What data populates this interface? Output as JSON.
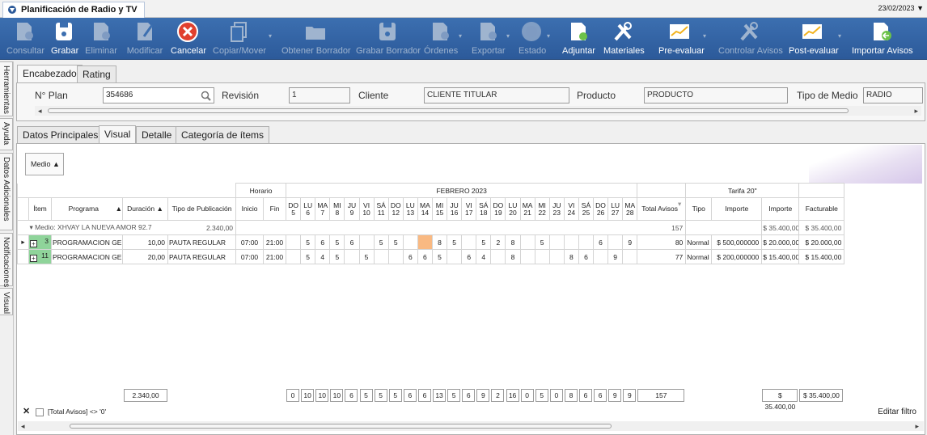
{
  "window": {
    "title": "Planificación de Radio y TV",
    "date": "23/02/2023"
  },
  "ribbon": [
    {
      "label": "Consultar",
      "enabled": false,
      "icon": "consultar-icon"
    },
    {
      "label": "Grabar",
      "enabled": true,
      "icon": "save-icon"
    },
    {
      "label": "Eliminar",
      "enabled": false,
      "icon": "delete-doc-icon"
    },
    {
      "label": "Modificar",
      "enabled": false,
      "icon": "edit-icon"
    },
    {
      "label": "Cancelar",
      "enabled": true,
      "icon": "cancel-icon"
    },
    {
      "label": "Copiar/Mover",
      "enabled": false,
      "icon": "copy-icon"
    },
    {
      "label": "Obtener Borrador",
      "enabled": false,
      "icon": "folder-icon"
    },
    {
      "label": "Grabar Borrador",
      "enabled": false,
      "icon": "save-draft-icon"
    },
    {
      "label": "Órdenes",
      "enabled": false,
      "icon": "orders-icon"
    },
    {
      "label": "Exportar",
      "enabled": false,
      "icon": "export-icon"
    },
    {
      "label": "Estado",
      "enabled": false,
      "icon": "status-icon"
    },
    {
      "label": "Adjuntar",
      "enabled": true,
      "icon": "attach-icon"
    },
    {
      "label": "Materiales",
      "enabled": true,
      "icon": "tools-icon"
    },
    {
      "label": "Pre-evaluar",
      "enabled": true,
      "icon": "chart-icon"
    },
    {
      "label": "Controlar Avisos",
      "enabled": false,
      "icon": "tools-disabled-icon"
    },
    {
      "label": "Post-evaluar",
      "enabled": true,
      "icon": "chart-post-icon"
    },
    {
      "label": "Importar Avisos",
      "enabled": true,
      "icon": "import-icon"
    }
  ],
  "side_tabs": [
    "Herramientas",
    "Ayuda",
    "Datos Adicionales",
    "Notificaciones",
    "Visual"
  ],
  "header": {
    "tabs": [
      "Encabezado",
      "Rating"
    ],
    "labels": {
      "plan": "N° Plan",
      "revision": "Revisión",
      "cliente": "Cliente",
      "producto": "Producto",
      "tipo_medio": "Tipo de Medio"
    },
    "values": {
      "plan": "354686",
      "revision": "1",
      "cliente": "CLIENTE TITULAR",
      "producto": "PRODUCTO",
      "tipo_medio": "RADIO"
    }
  },
  "content_tabs": [
    "Datos Principales",
    "Visual",
    "Detalle",
    "Categoría de ítems"
  ],
  "medio_button": "Medio",
  "grid": {
    "horario_header": "Horario",
    "month_header": "FEBRERO 2023",
    "tarifa_header": "Tarifa 20\"",
    "cols": {
      "item": "Ítem",
      "programa": "Programa",
      "duracion": "Duración",
      "tipo_pub": "Tipo de Publicación",
      "inicio": "Inicio",
      "fin": "Fin",
      "total_avisos": "Total Avisos",
      "tipo": "Tipo",
      "importe1": "Importe",
      "importe2": "Importe",
      "facturable": "Facturable"
    },
    "days": [
      [
        "DO",
        "5"
      ],
      [
        "LU",
        "6"
      ],
      [
        "MA",
        "7"
      ],
      [
        "MI",
        "8"
      ],
      [
        "JU",
        "9"
      ],
      [
        "VI",
        "10"
      ],
      [
        "SÁ",
        "11"
      ],
      [
        "DO",
        "12"
      ],
      [
        "LU",
        "13"
      ],
      [
        "MA",
        "14"
      ],
      [
        "MI",
        "15"
      ],
      [
        "JU",
        "16"
      ],
      [
        "VI",
        "17"
      ],
      [
        "SÁ",
        "18"
      ],
      [
        "DO",
        "19"
      ],
      [
        "LU",
        "20"
      ],
      [
        "MA",
        "21"
      ],
      [
        "MI",
        "22"
      ],
      [
        "JU",
        "23"
      ],
      [
        "VI",
        "24"
      ],
      [
        "SÁ",
        "25"
      ],
      [
        "DO",
        "26"
      ],
      [
        "LU",
        "27"
      ],
      [
        "MA",
        "28"
      ]
    ],
    "group": {
      "label": "Medio: XHVAY LA NUEVA AMOR 92.7",
      "duracion": "2.340,00",
      "total_avisos": "157",
      "importe2": "$ 35.400,00",
      "facturable": "$ 35.400,00"
    },
    "rows": [
      {
        "item": "3",
        "programa": "PROGRAMACION GENERAL",
        "duracion": "10,00",
        "tipo_pub": "PAUTA REGULAR",
        "inicio": "07:00",
        "fin": "21:00",
        "days": [
          "",
          "5",
          "6",
          "5",
          "6",
          "",
          "5",
          "5",
          "",
          "",
          "8",
          "5",
          "",
          "5",
          "2",
          "8",
          "",
          "5",
          "",
          "",
          "",
          "6",
          "",
          "9"
        ],
        "total_avisos": "80",
        "tipo": "Normal",
        "importe1": "$ 500,000000",
        "importe2": "$ 20.000,00",
        "facturable": "$ 20.000,00",
        "highlight_day": 9
      },
      {
        "item": "11",
        "programa": "PROGRAMACION GENERAL",
        "duracion": "20,00",
        "tipo_pub": "PAUTA REGULAR",
        "inicio": "07:00",
        "fin": "21:00",
        "days": [
          "",
          "5",
          "4",
          "5",
          "",
          "5",
          "",
          "",
          "6",
          "6",
          "5",
          "",
          "6",
          "4",
          "",
          "8",
          "",
          "",
          "",
          "8",
          "6",
          "",
          "9",
          ""
        ],
        "total_avisos": "77",
        "tipo": "Normal",
        "importe1": "$ 200,000000",
        "importe2": "$ 15.400,00",
        "facturable": "$ 15.400,00",
        "highlight_day": -1
      }
    ],
    "footer": {
      "duracion": "2.340,00",
      "days": [
        "0",
        "10",
        "10",
        "10",
        "6",
        "5",
        "5",
        "5",
        "6",
        "6",
        "13",
        "5",
        "6",
        "9",
        "2",
        "16",
        "0",
        "5",
        "0",
        "8",
        "6",
        "6",
        "9",
        "9"
      ],
      "total_avisos": "157",
      "importe2": "$ 35.400,00",
      "facturable": "$ 35.400,00"
    }
  },
  "filter": {
    "text": "[Total Avisos] <> '0'",
    "edit_label": "Editar filtro"
  }
}
